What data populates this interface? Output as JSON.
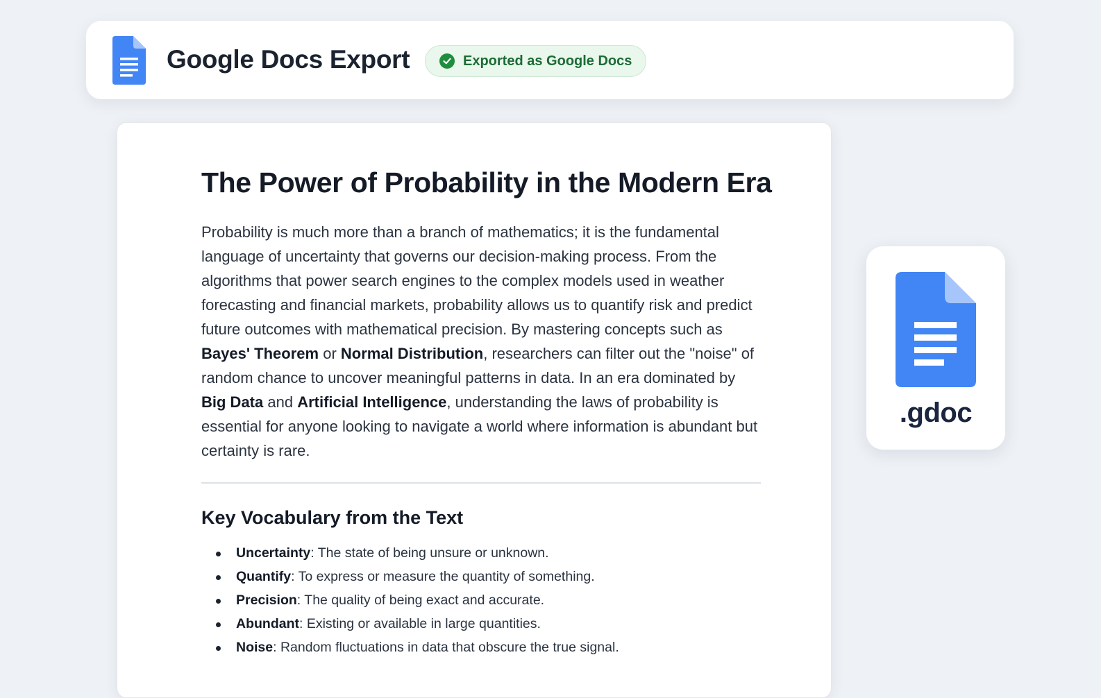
{
  "header": {
    "title": "Google Docs Export",
    "status": "Exported as Google Docs",
    "icon": "google-docs-icon",
    "status_icon": "check-circle-icon"
  },
  "document": {
    "title": "The Power of Probability in the Modern Era",
    "body": {
      "p1": "Probability is much more than a branch of mathematics; it is the fundamental language of uncertainty that governs our decision-making process. From the algorithms that power search engines to the complex models used in weather forecasting and financial markets, probability allows us to quantify risk and predict future outcomes with mathematical precision. By mastering concepts such as ",
      "b1": "Bayes' Theorem",
      "p2": " or ",
      "b2": "Normal Distribution",
      "p3": ", researchers can filter out the \"noise\" of random chance to uncover meaningful patterns in data. In an era dominated by ",
      "b3": "Big Data",
      "p4": " and ",
      "b4": "Artificial Intelligence",
      "p5": ", understanding the laws of probability is essential for anyone looking to navigate a world where information is abundant but certainty is rare."
    },
    "vocab_heading": "Key Vocabulary from the Text",
    "vocab": [
      {
        "term": "Uncertainty",
        "def": ": The state of being unsure or unknown."
      },
      {
        "term": "Quantify",
        "def": ": To express or measure the quantity of something."
      },
      {
        "term": "Precision",
        "def": ": The quality of being exact and accurate."
      },
      {
        "term": "Abundant",
        "def": ": Existing or available in large quantities."
      },
      {
        "term": "Noise",
        "def": ": Random fluctuations in data that obscure the true signal."
      }
    ]
  },
  "file_card": {
    "extension": ".gdoc",
    "icon": "google-docs-file-icon"
  },
  "colors": {
    "docs_blue": "#4285f4",
    "docs_fold": "#a6c5fa",
    "success_green": "#1e8e3e",
    "badge_bg": "#e9f7ec"
  }
}
